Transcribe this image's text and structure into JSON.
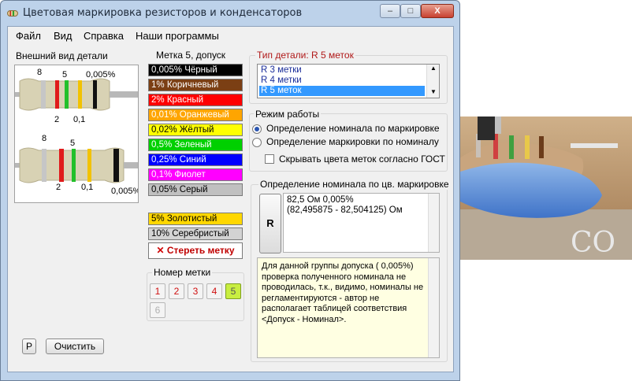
{
  "window": {
    "title": "Цветовая маркировка резисторов и конденсаторов",
    "close_glyph": "X",
    "minimize_glyph": "–",
    "maximize_glyph": "□"
  },
  "menu": [
    "Файл",
    "Вид",
    "Справка",
    "Наши программы"
  ],
  "appearance": {
    "label": "Внешний вид детали",
    "top_resistor": {
      "bands": [
        "#c6c6c6",
        "#e01b1b",
        "#22c02a",
        "#f2c200",
        "#111111"
      ],
      "labels_above": [
        "8",
        "5",
        "0,005%"
      ],
      "labels_below": [
        "2",
        "0,1"
      ]
    },
    "bottom_resistor": {
      "bands": [
        "#c6c6c6",
        "#e01b1b",
        "#22c02a",
        "#f2c200",
        "#111111"
      ],
      "labels_above": [
        "8",
        "5"
      ],
      "labels_below": [
        "2",
        "0,1",
        "0,005%"
      ]
    }
  },
  "colors_panel": {
    "label": "Метка 5, допуск",
    "items": [
      {
        "text": "0,005% Чёрный",
        "bg": "#000000",
        "fg": "#ffffff"
      },
      {
        "text": "1% Коричневый",
        "bg": "#7b3f14",
        "fg": "#ffffff"
      },
      {
        "text": "2% Красный",
        "bg": "#ff0000",
        "fg": "#ffffff"
      },
      {
        "text": "0,01% Оранжевый",
        "bg": "#ffa500",
        "fg": "#ffffff"
      },
      {
        "text": "0,02% Жёлтый",
        "bg": "#ffff00",
        "fg": "#000000"
      },
      {
        "text": "0,5% Зеленый",
        "bg": "#00d000",
        "fg": "#ffffff"
      },
      {
        "text": "0,25% Синий",
        "bg": "#0000ff",
        "fg": "#ffffff"
      },
      {
        "text": "0,1% Фиолет",
        "bg": "#ff00ff",
        "fg": "#ffffff"
      },
      {
        "text": "0,05% Серый",
        "bg": "#c0c0c0",
        "fg": "#000000"
      },
      {
        "text": "5% Золотистый",
        "bg": "#ffd700",
        "fg": "#000000"
      },
      {
        "text": "10% Серебристый",
        "bg": "#d3d3d3",
        "fg": "#000000"
      }
    ],
    "erase_label": "Стереть метку",
    "erase_icon": "x-icon"
  },
  "band_number": {
    "label": "Номер метки",
    "buttons": [
      "1",
      "2",
      "3",
      "4",
      "5",
      "6"
    ],
    "selected": "5"
  },
  "part_type": {
    "label": "Тип детали: R 5 меток",
    "options": [
      "R 3 метки",
      "R 4 метки",
      "R 5 меток"
    ],
    "selected": "R 5 меток"
  },
  "mode": {
    "label": "Режим работы",
    "options": [
      "Определение номинала по маркировке",
      "Определение маркировки по номиналу"
    ],
    "selected": 0,
    "gost_checkbox": "Скрывать цвета меток согласно ГОСТ",
    "gost_checked": false
  },
  "nominal": {
    "label": "Определение номинала по цв. маркировке",
    "r_button": "R",
    "result_line1": "82,5 Ом  0,005%",
    "result_line2": "(82,495875 - 82,504125) Ом",
    "note": "Для данной группы допуска ( 0,005%) проверка полученного номинала не проводилась, т.к., видимо, номиналы не регламентируются - автор не располагает таблицей соответствия <Допуск - Номинал>."
  },
  "bottom_buttons": {
    "p_label": "P",
    "clear_label": "Очистить"
  },
  "photo": {
    "overlay_text": "CO"
  },
  "accent": {
    "selection": "#3399ff",
    "list_text": "#1a2d9a"
  }
}
